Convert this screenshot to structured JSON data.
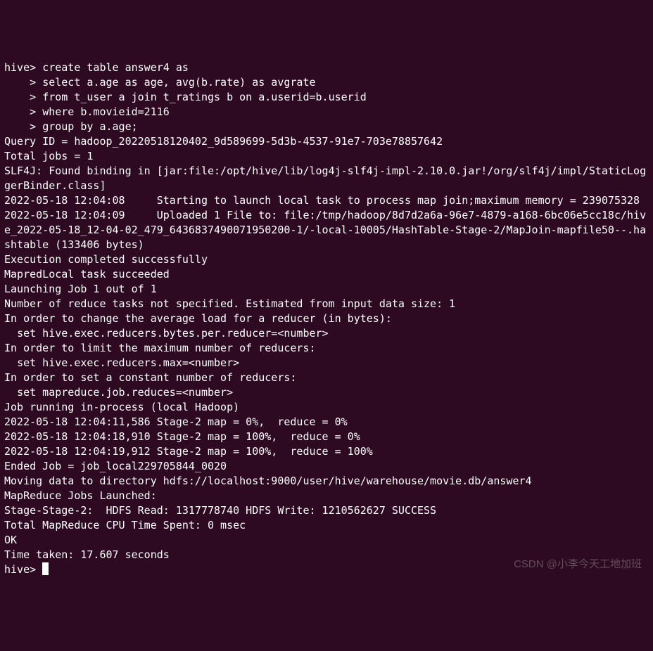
{
  "terminal": {
    "prompt1": "hive> ",
    "prompt2": "    > ",
    "sql": {
      "line1": "create table answer4 as",
      "line2": "select a.age as age, avg(b.rate) as avgrate",
      "line3": "from t_user a join t_ratings b on a.userid=b.userid",
      "line4": "where b.movieid=2116",
      "line5": "group by a.age;"
    },
    "output": {
      "l1": "Query ID = hadoop_20220518120402_9d589699-5d3b-4537-91e7-703e78857642",
      "l2": "Total jobs = 1",
      "l3": "SLF4J: Found binding in [jar:file:/opt/hive/lib/log4j-slf4j-impl-2.10.0.jar!/org/slf4j/impl/StaticLoggerBinder.class]",
      "l4": "2022-05-18 12:04:08     Starting to launch local task to process map join;maximum memory = 239075328",
      "l5": "",
      "l6": "2022-05-18 12:04:09     Uploaded 1 File to: file:/tmp/hadoop/8d7d2a6a-96e7-4879-a168-6bc06e5cc18c/hive_2022-05-18_12-04-02_479_6436837490071950200-1/-local-10005/HashTable-Stage-2/MapJoin-mapfile50--.hashtable (133406 bytes)",
      "l7": "Execution completed successfully",
      "l8": "MapredLocal task succeeded",
      "l9": "Launching Job 1 out of 1",
      "l10": "Number of reduce tasks not specified. Estimated from input data size: 1",
      "l11": "In order to change the average load for a reducer (in bytes):",
      "l12": "  set hive.exec.reducers.bytes.per.reducer=<number>",
      "l13": "In order to limit the maximum number of reducers:",
      "l14": "  set hive.exec.reducers.max=<number>",
      "l15": "In order to set a constant number of reducers:",
      "l16": "  set mapreduce.job.reduces=<number>",
      "l17": "Job running in-process (local Hadoop)",
      "l18": "2022-05-18 12:04:11,586 Stage-2 map = 0%,  reduce = 0%",
      "l19": "2022-05-18 12:04:18,910 Stage-2 map = 100%,  reduce = 0%",
      "l20": "2022-05-18 12:04:19,912 Stage-2 map = 100%,  reduce = 100%",
      "l21": "Ended Job = job_local229705844_0020",
      "l22": "Moving data to directory hdfs://localhost:9000/user/hive/warehouse/movie.db/answer4",
      "l23": "MapReduce Jobs Launched:",
      "l24": "Stage-Stage-2:  HDFS Read: 1317778740 HDFS Write: 1210562627 SUCCESS",
      "l25": "Total MapReduce CPU Time Spent: 0 msec",
      "l26": "OK",
      "l27": "Time taken: 17.607 seconds"
    },
    "finalPrompt": "hive> "
  },
  "watermark": "CSDN @小李今天工地加班"
}
